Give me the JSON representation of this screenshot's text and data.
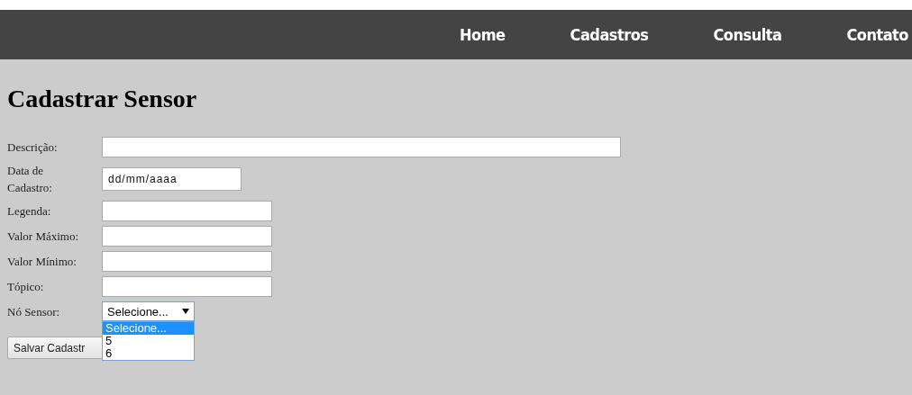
{
  "nav": [
    {
      "label": "Home"
    },
    {
      "label": "Cadastros"
    },
    {
      "label": "Consulta"
    },
    {
      "label": "Contato"
    }
  ],
  "title": "Cadastrar Sensor",
  "fields": [
    {
      "label": "Descrição:",
      "kind": "wide"
    },
    {
      "label": "Data de Cadastro:",
      "kind": "date",
      "placeholder": "dd/mm/aaaa"
    },
    {
      "label": "Legenda:",
      "kind": "text"
    },
    {
      "label": "Valor Máximo:",
      "kind": "text"
    },
    {
      "label": "Valor Mínimo:",
      "kind": "text"
    },
    {
      "label": "Tópico:",
      "kind": "text"
    },
    {
      "label": "Nó Sensor:",
      "kind": "select",
      "value": "Selecione...",
      "expanded": true,
      "options": [
        {
          "label": "Selecione...",
          "selected": true
        },
        {
          "label": "5",
          "selected": false
        },
        {
          "label": "6",
          "selected": false
        }
      ]
    }
  ],
  "submit": "Salvar Cadastr"
}
